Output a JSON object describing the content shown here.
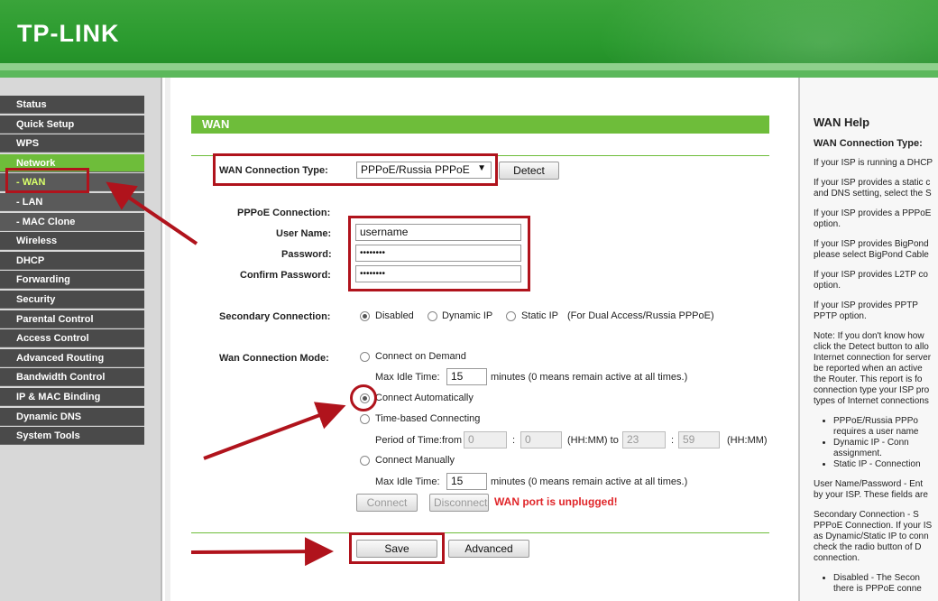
{
  "header": {
    "logo_text": "TP-LINK",
    "brand_color": "#2a9a2e"
  },
  "sidebar": {
    "items": [
      {
        "label": "Status"
      },
      {
        "label": "Quick Setup"
      },
      {
        "label": "WPS"
      },
      {
        "label": "Network"
      },
      {
        "label": "- WAN"
      },
      {
        "label": "- LAN"
      },
      {
        "label": "- MAC Clone"
      },
      {
        "label": "Wireless"
      },
      {
        "label": "DHCP"
      },
      {
        "label": "Forwarding"
      },
      {
        "label": "Security"
      },
      {
        "label": "Parental Control"
      },
      {
        "label": "Access Control"
      },
      {
        "label": "Advanced Routing"
      },
      {
        "label": "Bandwidth Control"
      },
      {
        "label": "IP & MAC Binding"
      },
      {
        "label": "Dynamic DNS"
      },
      {
        "label": "System Tools"
      }
    ]
  },
  "main": {
    "title": "WAN",
    "wan_type_label": "WAN Connection Type:",
    "wan_type_value": "PPPoE/Russia PPPoE",
    "detect_label": "Detect",
    "pppoe_label": "PPPoE Connection:",
    "username_label": "User Name:",
    "username_value": "username",
    "password_label": "Password:",
    "password_value": "••••••••",
    "confirm_label": "Confirm Password:",
    "confirm_value": "••••••••",
    "secondary_label": "Secondary Connection:",
    "secondary_options": [
      "Disabled",
      "Dynamic IP",
      "Static IP"
    ],
    "secondary_note": "(For Dual Access/Russia PPPoE)",
    "mode_label": "Wan Connection Mode:",
    "mode_on_demand": "Connect on Demand",
    "max_idle_label": "Max Idle Time:",
    "max_idle_value": "15",
    "minutes_note": "minutes (0 means remain active at all times.)",
    "mode_auto": "Connect Automatically",
    "mode_time": "Time-based Connecting",
    "period_label": "Period of Time:from",
    "from_hh": "0",
    "from_mm": "0",
    "hhmm_to": "(HH:MM) to",
    "to_hh": "23",
    "to_mm": "59",
    "hhmm": "(HH:MM)",
    "colon": ":",
    "mode_manual": "Connect Manually",
    "max_idle_value2": "15",
    "connect_label": "Connect",
    "disconnect_label": "Disconnect",
    "error_text": "WAN port is unplugged!",
    "save_label": "Save",
    "advanced_label": "Advanced",
    "highlight_color": "#b0131c"
  },
  "help": {
    "title": "WAN Help",
    "subtitle": "WAN Connection Type:",
    "p1": "If your ISP is running a DHCP",
    "p2": "If your ISP provides a static c",
    "p2b": "and DNS setting, select the S",
    "p3": "If your ISP provides a PPPoE",
    "p3b": "option.",
    "p4": "If your ISP provides BigPond",
    "p4b": "please select BigPond Cable",
    "p5": "If your ISP provides L2TP co",
    "p5b": "option.",
    "p6": "If your ISP provides PPTP",
    "p6b": "PPTP option.",
    "note1": "Note: If you don't know how",
    "note2": "click the Detect button to allo",
    "note3": "Internet connection for server",
    "note4": "be reported when an active",
    "note5": "the Router. This report is fo",
    "note6": "connection type your ISP pro",
    "note7": "types of Internet connections",
    "li1a": "PPPoE/Russia PPPo",
    "li1b": "requires a user name",
    "li2a": "Dynamic IP - Conn",
    "li2b": "assignment.",
    "li3": "Static IP - Connection",
    "up1": "User Name/Password - Ent",
    "up2": "by your ISP. These fields are",
    "sc1": "Secondary Connection - S",
    "sc2": "PPPoE Connection. If your IS",
    "sc3": "as Dynamic/Static IP to conn",
    "sc4": "check the radio button of D",
    "sc5": "connection.",
    "d1": "Disabled - The Secon",
    "d2": "there is PPPoE conne"
  }
}
